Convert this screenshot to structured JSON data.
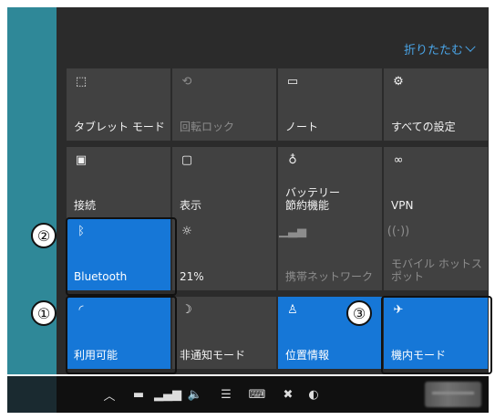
{
  "header": {
    "collapse_label": "折りたたむ"
  },
  "tiles": [
    {
      "label": "タブレット モード",
      "icon": "tablet-mode-icon",
      "glyph": "⬚",
      "state": "off"
    },
    {
      "label": "回転ロック",
      "icon": "rotation-lock-icon",
      "glyph": "⟲",
      "state": "disabled"
    },
    {
      "label": "ノート",
      "icon": "note-icon",
      "glyph": "▭",
      "state": "off"
    },
    {
      "label": "すべての設定",
      "icon": "gear-icon",
      "glyph": "⚙",
      "state": "off"
    },
    {
      "label": "接続",
      "icon": "connect-icon",
      "glyph": "▣",
      "state": "off"
    },
    {
      "label": "表示",
      "icon": "project-icon",
      "glyph": "▢",
      "state": "off"
    },
    {
      "label": "バッテリー\n節約機能",
      "icon": "battery-saver-icon",
      "glyph": "♁",
      "state": "off"
    },
    {
      "label": "VPN",
      "icon": "vpn-icon",
      "glyph": "∞",
      "state": "off"
    },
    {
      "label": "Bluetooth",
      "icon": "bluetooth-icon",
      "glyph": "ᛒ",
      "state": "on"
    },
    {
      "label": "21%",
      "icon": "brightness-icon",
      "glyph": "☼",
      "state": "off"
    },
    {
      "label": "携帯ネットワーク",
      "icon": "cellular-icon",
      "glyph": "▁▃▅",
      "state": "disabled"
    },
    {
      "label": "モバイル ホットス\nポット",
      "icon": "mobile-hotspot-icon",
      "glyph": "((·))",
      "state": "disabled"
    },
    {
      "label": "利用可能",
      "icon": "wifi-icon",
      "glyph": "◜",
      "state": "on"
    },
    {
      "label": "非通知モード",
      "icon": "quiet-hours-icon",
      "glyph": "☽",
      "state": "off"
    },
    {
      "label": "位置情報",
      "icon": "location-icon",
      "glyph": "♙",
      "state": "on"
    },
    {
      "label": "機内モード",
      "icon": "airplane-icon",
      "glyph": "✈",
      "state": "on"
    }
  ],
  "callouts": [
    {
      "number": "②"
    },
    {
      "number": "①"
    },
    {
      "number": "③"
    }
  ],
  "taskbar": {
    "icons": [
      {
        "name": "show-hidden-icons-icon",
        "glyph": "︿"
      },
      {
        "name": "battery-icon",
        "glyph": "▬"
      },
      {
        "name": "network-signal-icon",
        "glyph": "▂▄▆"
      },
      {
        "name": "volume-icon",
        "glyph": "🔈"
      },
      {
        "name": "action-center-icon",
        "glyph": "☰"
      },
      {
        "name": "touch-keyboard-icon",
        "glyph": "⌨"
      },
      {
        "name": "close-circle-icon",
        "glyph": "✖"
      },
      {
        "name": "app-tray-icon",
        "glyph": "◐"
      }
    ]
  },
  "colors": {
    "accent": "#1677d7",
    "tile": "#414141",
    "panel": "#2b2b2b",
    "link": "#4aa5e8",
    "taskbar": "#101010"
  }
}
